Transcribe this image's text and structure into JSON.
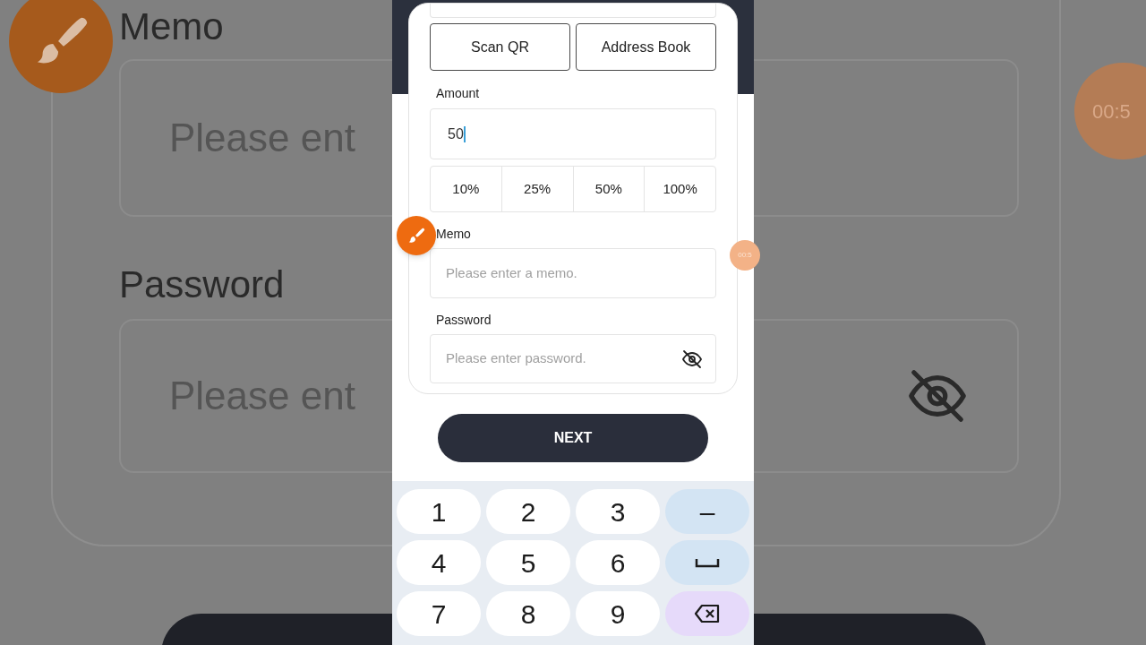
{
  "background": {
    "memo_label": "Memo",
    "memo_placeholder": "Please ent",
    "password_label": "Password",
    "password_placeholder": "Please ent",
    "timer": "00:5"
  },
  "address_buttons": [
    "Scan QR",
    "Address Book"
  ],
  "amount": {
    "label": "Amount",
    "value": "50"
  },
  "percent_options": [
    "10%",
    "25%",
    "50%",
    "100%"
  ],
  "memo": {
    "label": "Memo",
    "placeholder": "Please enter a memo."
  },
  "password": {
    "label": "Password",
    "placeholder": "Please enter password.",
    "visible": false
  },
  "next_button": "NEXT",
  "timer": "00:5",
  "keyboard": [
    {
      "kind": "digit",
      "label": "1"
    },
    {
      "kind": "digit",
      "label": "2"
    },
    {
      "kind": "digit",
      "label": "3"
    },
    {
      "kind": "minus",
      "label": "–"
    },
    {
      "kind": "digit",
      "label": "4"
    },
    {
      "kind": "digit",
      "label": "5"
    },
    {
      "kind": "digit",
      "label": "6"
    },
    {
      "kind": "space"
    },
    {
      "kind": "digit",
      "label": "7"
    },
    {
      "kind": "digit",
      "label": "8"
    },
    {
      "kind": "digit",
      "label": "9"
    },
    {
      "kind": "backspace"
    }
  ]
}
